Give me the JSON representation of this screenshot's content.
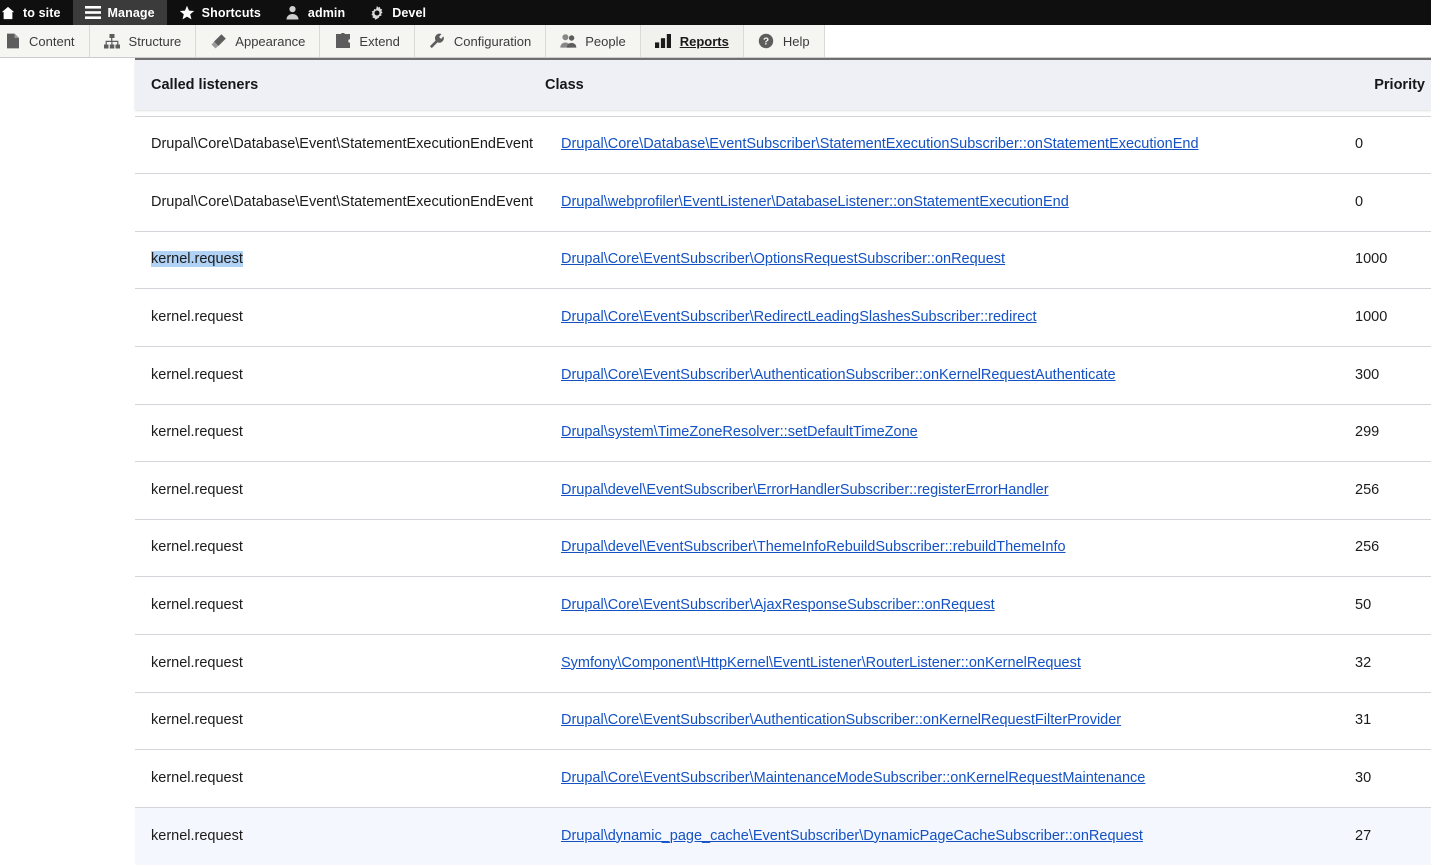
{
  "toolbar": {
    "items": [
      {
        "label": "to site",
        "icon": "home-icon"
      },
      {
        "label": "Manage",
        "icon": "hamburger-icon"
      },
      {
        "label": "Shortcuts",
        "icon": "star-icon"
      },
      {
        "label": "admin",
        "icon": "user-icon"
      },
      {
        "label": "Devel",
        "icon": "gear-icon"
      }
    ]
  },
  "admin_menu": {
    "items": [
      {
        "label": "Content",
        "icon": "file-icon"
      },
      {
        "label": "Structure",
        "icon": "structure-icon"
      },
      {
        "label": "Appearance",
        "icon": "brush-icon"
      },
      {
        "label": "Extend",
        "icon": "puzzle-icon"
      },
      {
        "label": "Configuration",
        "icon": "wrench-icon"
      },
      {
        "label": "People",
        "icon": "people-icon"
      },
      {
        "label": "Reports",
        "icon": "bar-chart-icon"
      },
      {
        "label": "Help",
        "icon": "question-icon"
      }
    ]
  },
  "table": {
    "headers": {
      "listener": "Called listeners",
      "class": "Class",
      "priority": "Priority"
    },
    "rows": [
      {
        "listener": "",
        "class": "",
        "priority": "",
        "clipped": true
      },
      {
        "listener": "Drupal\\Core\\Database\\Event\\StatementExecutionEndEvent",
        "class": "Drupal\\Core\\Database\\EventSubscriber\\StatementExecutionSubscriber::onStatementExecutionEnd",
        "priority": "0"
      },
      {
        "listener": "Drupal\\Core\\Database\\Event\\StatementExecutionEndEvent",
        "class": "Drupal\\webprofiler\\EventListener\\DatabaseListener::onStatementExecutionEnd",
        "priority": "0"
      },
      {
        "listener": "kernel.request",
        "class": "Drupal\\Core\\EventSubscriber\\OptionsRequestSubscriber::onRequest",
        "priority": "1000",
        "selected": true
      },
      {
        "listener": "kernel.request",
        "class": "Drupal\\Core\\EventSubscriber\\RedirectLeadingSlashesSubscriber::redirect",
        "priority": "1000"
      },
      {
        "listener": "kernel.request",
        "class": "Drupal\\Core\\EventSubscriber\\AuthenticationSubscriber::onKernelRequestAuthenticate",
        "priority": "300"
      },
      {
        "listener": "kernel.request",
        "class": "Drupal\\system\\TimeZoneResolver::setDefaultTimeZone",
        "priority": "299"
      },
      {
        "listener": "kernel.request",
        "class": "Drupal\\devel\\EventSubscriber\\ErrorHandlerSubscriber::registerErrorHandler",
        "priority": "256"
      },
      {
        "listener": "kernel.request",
        "class": "Drupal\\devel\\EventSubscriber\\ThemeInfoRebuildSubscriber::rebuildThemeInfo",
        "priority": "256"
      },
      {
        "listener": "kernel.request",
        "class": "Drupal\\Core\\EventSubscriber\\AjaxResponseSubscriber::onRequest",
        "priority": "50"
      },
      {
        "listener": "kernel.request",
        "class": "Symfony\\Component\\HttpKernel\\EventListener\\RouterListener::onKernelRequest",
        "priority": "32"
      },
      {
        "listener": "kernel.request",
        "class": "Drupal\\Core\\EventSubscriber\\AuthenticationSubscriber::onKernelRequestFilterProvider",
        "priority": "31"
      },
      {
        "listener": "kernel.request",
        "class": "Drupal\\Core\\EventSubscriber\\MaintenanceModeSubscriber::onKernelRequestMaintenance",
        "priority": "30"
      },
      {
        "listener": "kernel.request",
        "class": "Drupal\\dynamic_page_cache\\EventSubscriber\\DynamicPageCacheSubscriber::onRequest",
        "priority": "27",
        "alt": true
      }
    ]
  },
  "colors": {
    "toolbar_bg": "#0f0f0f",
    "toolbar_active": "#3b3b3b",
    "menu_bg": "#f5f5f2",
    "link": "#1452c4",
    "selection": "#b0d2f5",
    "header_bg": "#eef0f6",
    "row_alt": "#f4f7fd"
  }
}
